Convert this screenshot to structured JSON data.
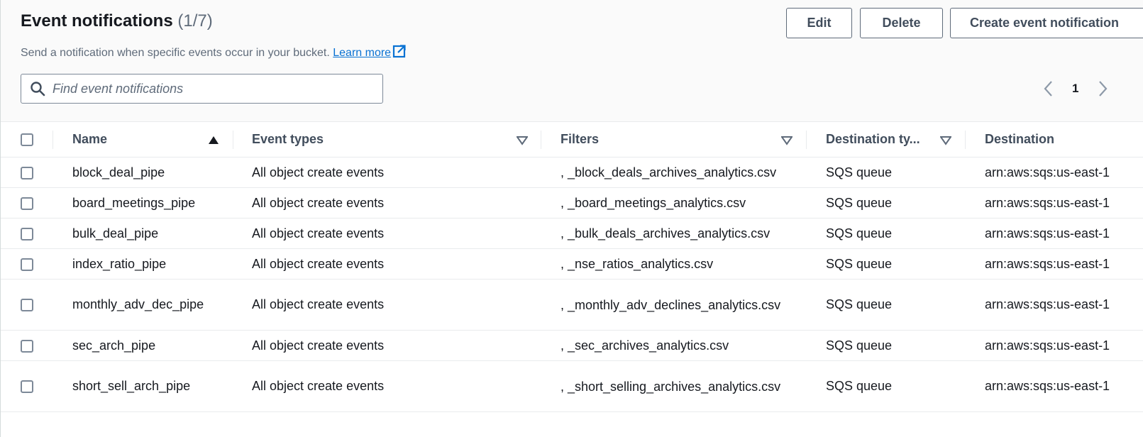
{
  "header": {
    "title": "Event notifications",
    "count": "(1/7)",
    "description": "Send a notification when specific events occur in your bucket.",
    "learn_more": "Learn more"
  },
  "buttons": {
    "edit": "Edit",
    "delete": "Delete",
    "create": "Create event notification"
  },
  "search": {
    "placeholder": "Find event notifications"
  },
  "pagination": {
    "current_page": "1"
  },
  "columns": {
    "name": "Name",
    "event_types": "Event types",
    "filters": "Filters",
    "destination_type": "Destination ty...",
    "destination": "Destination"
  },
  "rows": [
    {
      "name": "block_deal_pipe",
      "event_types": "All object create events",
      "filters": ", _block_deals_archives_analytics.csv",
      "destination_type": "SQS queue",
      "destination": "arn:aws:sqs:us-east-1"
    },
    {
      "name": "board_meetings_pipe",
      "event_types": "All object create events",
      "filters": ", _board_meetings_analytics.csv",
      "destination_type": "SQS queue",
      "destination": "arn:aws:sqs:us-east-1"
    },
    {
      "name": "bulk_deal_pipe",
      "event_types": "All object create events",
      "filters": ", _bulk_deals_archives_analytics.csv",
      "destination_type": "SQS queue",
      "destination": "arn:aws:sqs:us-east-1"
    },
    {
      "name": "index_ratio_pipe",
      "event_types": "All object create events",
      "filters": ", _nse_ratios_analytics.csv",
      "destination_type": "SQS queue",
      "destination": "arn:aws:sqs:us-east-1"
    },
    {
      "name": "monthly_adv_dec_pipe",
      "event_types": "All object create events",
      "filters": ", _monthly_adv_declines_analytics.csv",
      "destination_type": "SQS queue",
      "destination": "arn:aws:sqs:us-east-1"
    },
    {
      "name": "sec_arch_pipe",
      "event_types": "All object create events",
      "filters": ", _sec_archives_analytics.csv",
      "destination_type": "SQS queue",
      "destination": "arn:aws:sqs:us-east-1"
    },
    {
      "name": "short_sell_arch_pipe",
      "event_types": "All object create events",
      "filters": ", _short_selling_archives_analytics.csv",
      "destination_type": "SQS queue",
      "destination": "arn:aws:sqs:us-east-1"
    }
  ],
  "icons": {
    "search": "search-icon",
    "external": "external-link-icon",
    "sort_asc": "sort-ascending-icon",
    "sort": "sort-icon",
    "prev": "chevron-left-icon",
    "next": "chevron-right-icon"
  },
  "colors": {
    "link": "#0972d3",
    "text": "#16191f",
    "secondary_text": "#5f6b7a",
    "border": "#e9ebed"
  }
}
